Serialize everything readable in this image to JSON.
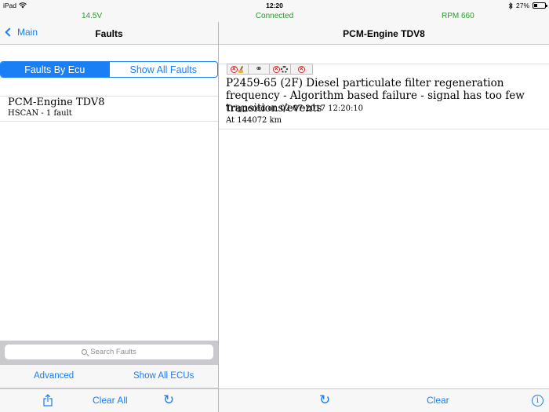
{
  "status_bar": {
    "device": "iPad",
    "time": "12:20",
    "battery_percent_text": "27%",
    "battery_level": 0.27
  },
  "connection_bar": {
    "voltage": "14.5V",
    "status": "Connected",
    "rpm": "RPM 660",
    "color": "#2b9a2b"
  },
  "left": {
    "nav": {
      "back_label": "Main",
      "title": "Faults"
    },
    "segments": [
      {
        "label": "Faults By Ecu",
        "selected": true
      },
      {
        "label": "Show All Faults",
        "selected": false
      }
    ],
    "ecus": [
      {
        "name": "PCM-Engine TDV8",
        "subtitle": "HSCAN - 1 fault"
      }
    ],
    "search": {
      "placeholder": "Search Faults"
    },
    "links": {
      "advanced": "Advanced",
      "show_all_ecus": "Show All ECUs"
    },
    "toolbar": {
      "clear_all": "Clear All"
    }
  },
  "right": {
    "nav": {
      "title": "PCM-Engine TDV8"
    },
    "fault": {
      "flags": [
        "error-icon",
        "broom-icon",
        "chain-link-icon",
        "error-icon",
        "gear-icon",
        "error-icon"
      ],
      "title": "P2459-65 (2F) Diesel particulate filter regeneration frequency - Algorithm based failure - signal has too few transitions/events",
      "triggered": "Triggered on 02-07-2017 12:20:10",
      "odometer": "At 144072 km"
    },
    "toolbar": {
      "clear": "Clear"
    }
  },
  "colors": {
    "accent": "#1a7ef5",
    "connected": "#2b9a2b",
    "error": "#d62323"
  }
}
